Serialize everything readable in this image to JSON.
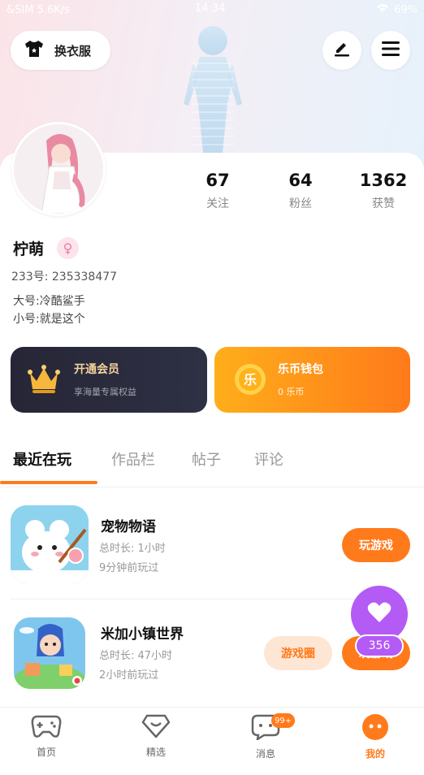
{
  "status_bar": {
    "left": "&SIM 5.6K/s",
    "time": "14:34",
    "battery": "69%"
  },
  "header": {
    "costume_label": "换衣服"
  },
  "profile": {
    "stats": [
      {
        "value": "67",
        "label": "关注"
      },
      {
        "value": "64",
        "label": "粉丝"
      },
      {
        "value": "1362",
        "label": "获赞"
      }
    ],
    "name": "柠萌",
    "uid": "233号: 235338477",
    "bio": [
      "大号:冷酷鲨手",
      "小号:就是这个"
    ]
  },
  "promos": {
    "vip": {
      "title": "开通会员",
      "subtitle": "享海量专属权益"
    },
    "wallet": {
      "title": "乐币钱包",
      "subtitle": "0 乐币"
    }
  },
  "tabs": [
    {
      "label": "最近在玩"
    },
    {
      "label": "作品栏"
    },
    {
      "label": "帖子"
    },
    {
      "label": "评论"
    }
  ],
  "games": [
    {
      "name": "宠物物语",
      "total": "总时长: 1小时",
      "last": "9分钟前玩过",
      "action": "玩游戏"
    },
    {
      "name": "米加小镇世界",
      "total": "总时长: 47小时",
      "last": "2小时前玩过",
      "secondary": "游戏圈",
      "action": "玩游戏"
    }
  ],
  "like_fab": {
    "count": "356"
  },
  "bottom_nav": [
    {
      "label": "首页"
    },
    {
      "label": "精选"
    },
    {
      "label": "消息",
      "badge": "99+"
    },
    {
      "label": "我的"
    }
  ]
}
